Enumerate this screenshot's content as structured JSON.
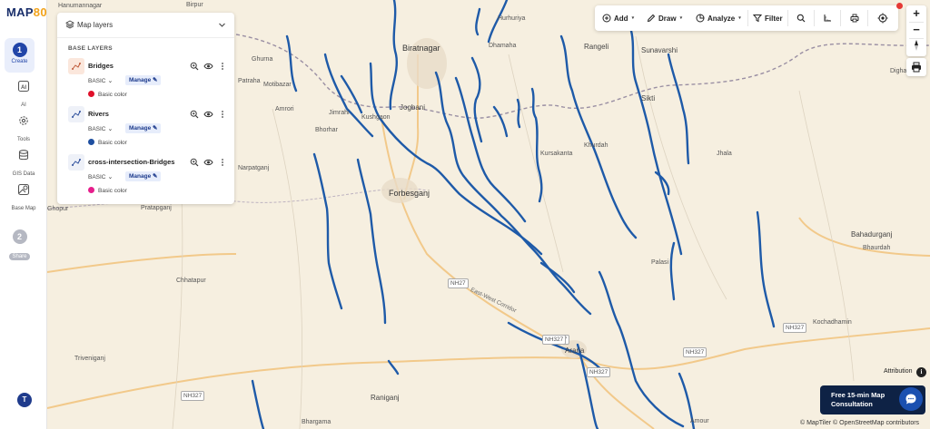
{
  "app": {
    "logo_prefix": "MAP",
    "logo_accent": "80"
  },
  "sidebar": {
    "steps": [
      {
        "number": "1",
        "label": "Create"
      },
      {
        "number": "2",
        "label": "Share"
      }
    ],
    "tools": [
      {
        "label": "AI",
        "icon": "ai-icon"
      },
      {
        "label": "Tools",
        "icon": "gear-icon"
      },
      {
        "label": "GIS Data",
        "icon": "database-icon"
      },
      {
        "label": "Base Map",
        "icon": "basemap-icon"
      }
    ],
    "user_initial": "T"
  },
  "layers_panel": {
    "title": "Map layers",
    "section_label": "BASE LAYERS",
    "layers": [
      {
        "name": "Bridges",
        "style": "BASIC",
        "manage_label": "Manage",
        "color_label": "Basic color",
        "color": "#e0102a"
      },
      {
        "name": "Rivers",
        "style": "BASIC",
        "manage_label": "Manage",
        "color_label": "Basic color",
        "color": "#1e4fa0"
      },
      {
        "name": "cross-intersection-Bridges",
        "style": "BASIC",
        "manage_label": "Manage",
        "color_label": "Basic color",
        "color": "#e61e8c"
      }
    ]
  },
  "toolbar": {
    "add_label": "Add",
    "draw_label": "Draw",
    "analyze_label": "Analyze",
    "filter_label": "Filter"
  },
  "zoom": {
    "in_label": "+",
    "out_label": "−"
  },
  "map": {
    "river_color": "#1e5aa8",
    "places": [
      {
        "name": "Biratnagar",
        "kind": "city"
      },
      {
        "name": "Forbesganj",
        "kind": "city"
      },
      {
        "name": "Jogbani",
        "kind": "town"
      },
      {
        "name": "Rangeli",
        "kind": "town"
      },
      {
        "name": "Sunavarshi",
        "kind": "town"
      },
      {
        "name": "Sikti",
        "kind": "town"
      },
      {
        "name": "Araria",
        "kind": "town"
      },
      {
        "name": "Raniganj",
        "kind": "town"
      },
      {
        "name": "Bahadurganj",
        "kind": "town"
      },
      {
        "name": "Narpatganj",
        "kind": "village"
      },
      {
        "name": "Pratapganj",
        "kind": "village"
      },
      {
        "name": "Chhatapur",
        "kind": "village"
      },
      {
        "name": "Triveniganj",
        "kind": "village"
      },
      {
        "name": "Bhargama",
        "kind": "village"
      },
      {
        "name": "Palasi",
        "kind": "village"
      },
      {
        "name": "Kochadhamin",
        "kind": "village"
      },
      {
        "name": "Bhaurdah",
        "kind": "village"
      },
      {
        "name": "Kursakanta",
        "kind": "village"
      },
      {
        "name": "Khurdah",
        "kind": "village"
      },
      {
        "name": "Jhala",
        "kind": "village"
      },
      {
        "name": "Bhorhar",
        "kind": "village"
      },
      {
        "name": "Amrori",
        "kind": "village"
      },
      {
        "name": "Jimrahi",
        "kind": "village"
      },
      {
        "name": "Kushgaon",
        "kind": "village"
      },
      {
        "name": "Ghurna",
        "kind": "village"
      },
      {
        "name": "Patraha",
        "kind": "village"
      },
      {
        "name": "Motibazar",
        "kind": "village"
      },
      {
        "name": "Dhamaha",
        "kind": "village"
      },
      {
        "name": "Hurhuriya",
        "kind": "village"
      },
      {
        "name": "Birpur",
        "kind": "village"
      },
      {
        "name": "Digha",
        "kind": "village"
      },
      {
        "name": "Amour",
        "kind": "village"
      },
      {
        "name": "Ghopur",
        "kind": "village"
      },
      {
        "name": "Hanumannagar",
        "kind": "village"
      }
    ],
    "road_shields": [
      "NH27",
      "NH327",
      "NH327",
      "NH327",
      "NH327",
      "NH327",
      "NH327"
    ],
    "road_name": "East-West Corridor"
  },
  "footer": {
    "attribution_label": "Attribution",
    "consult_label": "Free 15-min Map Consultation",
    "copyright": "© MapTiler © OpenStreetMap contributors"
  }
}
